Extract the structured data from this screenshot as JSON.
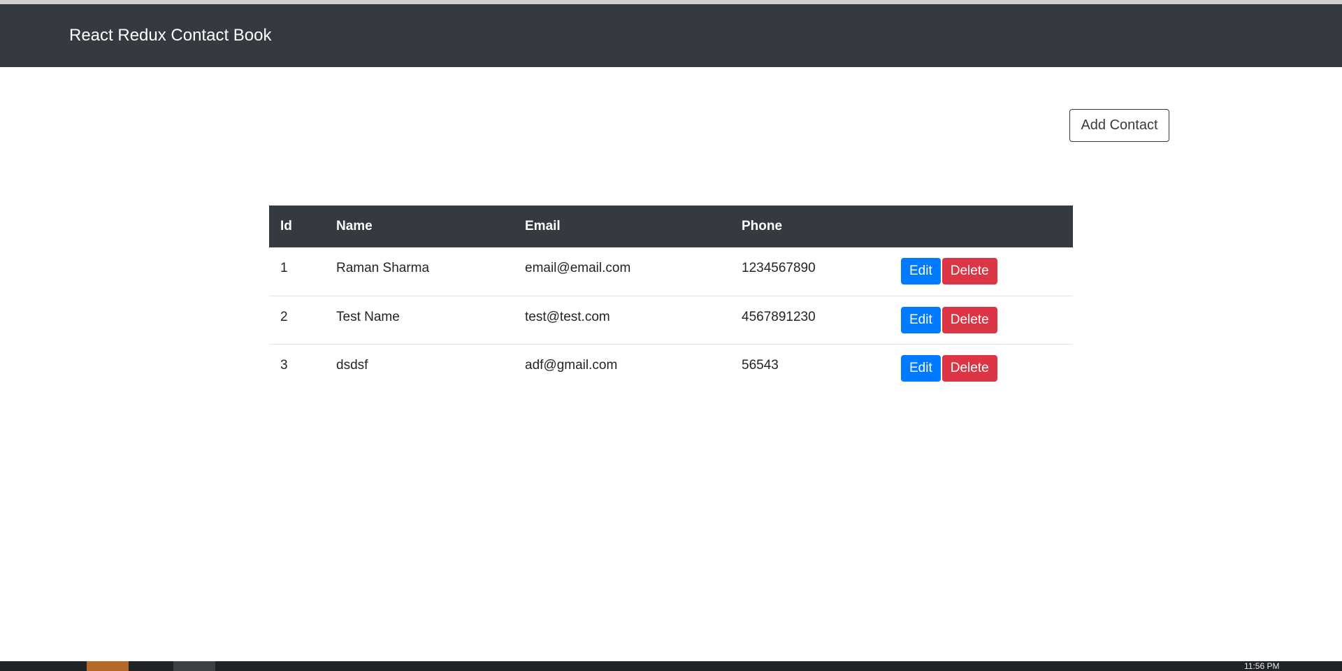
{
  "app": {
    "brand": "React Redux Contact Book"
  },
  "toolbar": {
    "add_label": "Add Contact"
  },
  "table": {
    "headers": [
      "Id",
      "Name",
      "Email",
      "Phone",
      ""
    ],
    "rows": [
      {
        "id": "1",
        "name": "Raman Sharma",
        "email": "email@email.com",
        "phone": "1234567890"
      },
      {
        "id": "2",
        "name": "Test Name",
        "email": "test@test.com",
        "phone": "4567891230"
      },
      {
        "id": "3",
        "name": "dsdsf",
        "email": "adf@gmail.com",
        "phone": "56543"
      }
    ],
    "edit_label": "Edit",
    "delete_label": "Delete"
  },
  "taskbar": {
    "clock": "11:56 PM"
  },
  "colors": {
    "navbar": "#343a40",
    "edit": "#007bff",
    "delete": "#dc3545"
  }
}
